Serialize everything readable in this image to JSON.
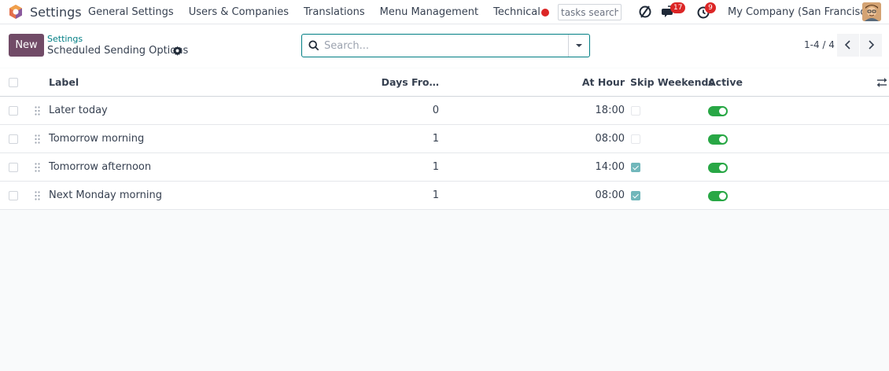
{
  "app": {
    "name": "Settings",
    "logo_icon": "odoo-app-logo-icon"
  },
  "menu": [
    {
      "label": "General Settings"
    },
    {
      "label": "Users & Companies"
    },
    {
      "label": "Translations"
    },
    {
      "label": "Menu Management"
    },
    {
      "label": "Technical"
    }
  ],
  "systray": {
    "tasks_search_placeholder": "tasks search",
    "messages_count": "17",
    "activities_count": "9",
    "company": "My Company (San Francisco)"
  },
  "control": {
    "new_label": "New",
    "breadcrumb_parent": "Settings",
    "breadcrumb_current": "Scheduled Sending Options",
    "search_placeholder": "Search...",
    "pager": "1-4 / 4"
  },
  "table": {
    "columns": {
      "label": "Label",
      "days": "Days Fro…",
      "hour": "At Hour",
      "skip": "Skip Weekends",
      "active": "Active"
    },
    "rows": [
      {
        "label": "Later today",
        "days": "0",
        "hour": "18:00",
        "skip_weekends": false,
        "active": true
      },
      {
        "label": "Tomorrow morning",
        "days": "1",
        "hour": "08:00",
        "skip_weekends": false,
        "active": true
      },
      {
        "label": "Tomorrow afternoon",
        "days": "1",
        "hour": "14:00",
        "skip_weekends": true,
        "active": true
      },
      {
        "label": "Next Monday morning",
        "days": "1",
        "hour": "08:00",
        "skip_weekends": true,
        "active": true
      }
    ]
  },
  "colors": {
    "brand": "#714b67",
    "accent": "#017e84",
    "toggle_on": "#28a745",
    "badge": "#dc2626",
    "checkbox_on": "#71b7bb"
  }
}
